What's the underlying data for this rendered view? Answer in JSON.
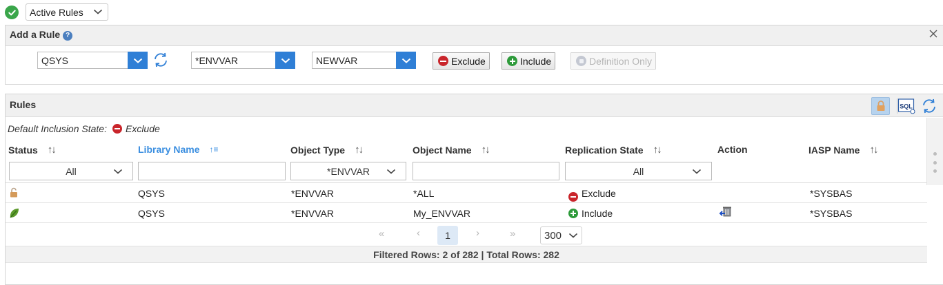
{
  "top": {
    "rules_view_select": "Active Rules"
  },
  "add_rule": {
    "title": "Add a Rule",
    "help_icon": "?",
    "library_value": "QSYS",
    "object_type_value": "*ENVVAR",
    "object_name_value": "NEWVAR",
    "exclude_label": "Exclude",
    "include_label": "Include",
    "definition_only_label": "Definition Only"
  },
  "rules": {
    "title": "Rules",
    "sql_label": "SQL",
    "default_inclusion_label": "Default Inclusion State:",
    "default_inclusion_value": "Exclude",
    "columns": {
      "status": "Status",
      "library_name": "Library Name",
      "object_type": "Object Type",
      "object_name": "Object Name",
      "replication_state": "Replication State",
      "action": "Action",
      "iasp_name": "IASP Name"
    },
    "filters": {
      "status": "All",
      "library_name": "",
      "object_type": "*ENVVAR",
      "object_name": "",
      "replication_state": "All"
    },
    "rows": [
      {
        "status_icon": "lock-icon",
        "library": "QSYS",
        "object_type": "*ENVVAR",
        "object_name": "*ALL",
        "replication_state": "Exclude",
        "state_icon": "exclude-icon",
        "action_icon": "",
        "iasp": "*SYSBAS"
      },
      {
        "status_icon": "leaf-icon",
        "library": "QSYS",
        "object_type": "*ENVVAR",
        "object_name": "My_ENVVAR",
        "replication_state": "Include",
        "state_icon": "include-icon",
        "action_icon": "delete-rule-icon",
        "iasp": "*SYSBAS"
      }
    ],
    "pager": {
      "first": "«",
      "prev": "‹",
      "current_page": "1",
      "next": "›",
      "last": "»",
      "page_size": "300"
    },
    "footer": "Filtered Rows: 2 of 282 | Total Rows: 282"
  },
  "colors": {
    "accent": "#2f7fd6",
    "include": "#2d9a3a",
    "exclude": "#c9252b",
    "ok": "#3aa64a"
  }
}
